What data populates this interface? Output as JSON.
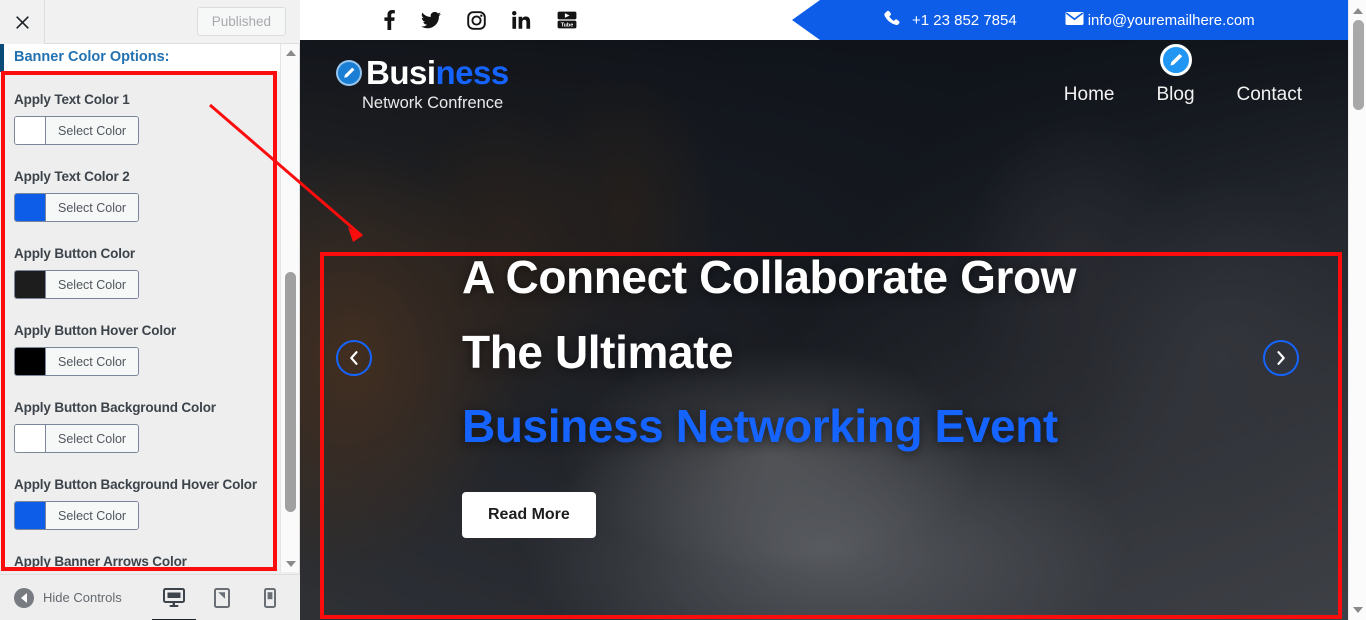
{
  "customizer": {
    "close_label": "Close",
    "published_label": "Published",
    "section_title": "Banner Color Options:",
    "select_color_label": "Select Color",
    "fields": [
      {
        "label": "Apply Text Color 1",
        "swatch": "#ffffff"
      },
      {
        "label": "Apply Text Color 2",
        "swatch": "#0d5de8"
      },
      {
        "label": "Apply Button Color",
        "swatch": "#1d1d1d"
      },
      {
        "label": "Apply Button Hover Color",
        "swatch": "#000000"
      },
      {
        "label": "Apply Button Background Color",
        "swatch": "#ffffff"
      },
      {
        "label": "Apply Button Background Hover Color",
        "swatch": "#0d5de8"
      },
      {
        "label": "Apply Banner Arrows Color",
        "swatch": "#ffffff"
      }
    ],
    "footer": {
      "hide_controls_label": "Hide Controls",
      "devices": [
        {
          "name": "desktop",
          "active": true
        },
        {
          "name": "tablet",
          "active": false
        },
        {
          "name": "mobile",
          "active": false
        }
      ]
    }
  },
  "preview": {
    "topbar": {
      "social": [
        "facebook",
        "twitter",
        "instagram",
        "linkedin",
        "youtube"
      ],
      "phone": "+1 23 852 7854",
      "email": "info@youremailhere.com"
    },
    "logo": {
      "text_part1": "Busi",
      "text_part2": "ness",
      "tagline": "Network Confrence"
    },
    "nav": [
      {
        "label": "Home",
        "edit_badge": false
      },
      {
        "label": "Blog",
        "edit_badge": true
      },
      {
        "label": "Contact",
        "edit_badge": false
      }
    ],
    "hero": {
      "line1": "A Connect Collaborate Grow",
      "line2": "The Ultimate",
      "line3": "Business Networking Event",
      "button_label": "Read More",
      "prev_label": "Previous slide",
      "next_label": "Next slide"
    }
  },
  "colors": {
    "brand_blue": "#0d5de8",
    "accent_blue": "#1564ff",
    "annotation_red": "#fc0d0d",
    "panel_bg": "#eeeeee",
    "section_title_color": "#2271b1"
  }
}
